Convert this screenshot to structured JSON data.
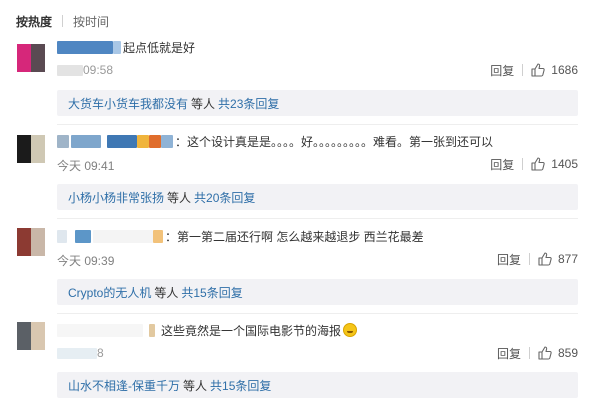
{
  "sort": {
    "hot": "按热度",
    "time": "按时间"
  },
  "comments": [
    {
      "text": "起点低就是好",
      "time": "",
      "time_fragment": "09:58",
      "reply_label": "回复",
      "likes": "1686",
      "thread": {
        "user": "大货车小货车我都没有",
        "etc": "等人",
        "total": "共23条回复"
      }
    },
    {
      "text": "：这个设计真是是。。。。好。。。。。。。。。难看。第一张到还可以",
      "time": "今天 09:41",
      "reply_label": "回复",
      "likes": "1405",
      "thread": {
        "user": "小杨小杨非常张扬",
        "etc": "等人",
        "total": "共20条回复"
      }
    },
    {
      "text": "：第一第二届还行啊 怎么越来越退步 西兰花最差",
      "time": "今天 09:39",
      "reply_label": "回复",
      "likes": "877",
      "thread": {
        "user": "Crypto的无人机",
        "etc": "等人",
        "total": "共15条回复"
      }
    },
    {
      "text": "这些竟然是一个国际电影节的海报",
      "time": "",
      "time_fragment": "8",
      "reply_label": "回复",
      "likes": "859",
      "thread": {
        "user": "山水不相逢-保重千万",
        "etc": "等人",
        "total": "共15条回复"
      }
    }
  ],
  "icons": {
    "like": "thumbs-up-icon",
    "emoji": "laughing-emoji-icon"
  },
  "colors": {
    "link": "#2f6fa8",
    "reply_bg": "#f2f2f5",
    "meta": "#808080"
  }
}
